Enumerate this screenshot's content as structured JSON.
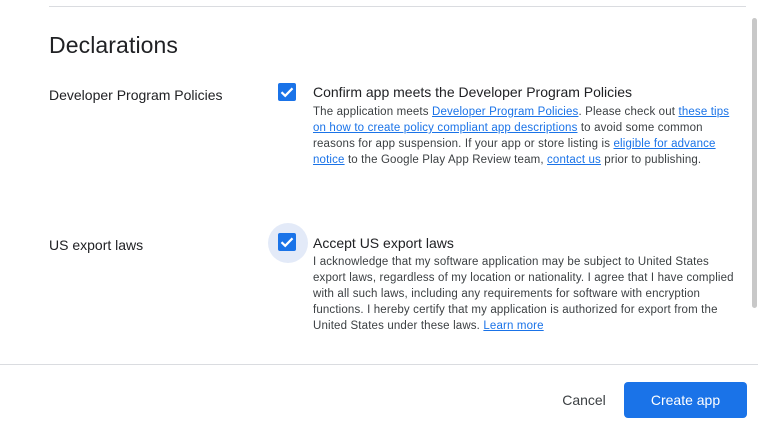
{
  "section": {
    "title": "Declarations"
  },
  "policies": {
    "label": "Developer Program Policies",
    "checked": true,
    "title": "Confirm app meets the Developer Program Policies",
    "desc": {
      "t1": "The application meets ",
      "l1": "Developer Program Policies",
      "t2": ". Please check out ",
      "l2": "these tips on how to create policy compliant app descriptions",
      "t3": " to avoid some common reasons for app suspension. If your app or store listing is ",
      "l3": "eligible for advance notice",
      "t4": " to the Google Play App Review team, ",
      "l4": "contact us",
      "t5": " prior to publishing."
    }
  },
  "export": {
    "label": "US export laws",
    "checked": true,
    "title": "Accept US export laws",
    "desc": {
      "t1": "I acknowledge that my software application may be subject to United States export laws, regardless of my location or nationality. I agree that I have complied with all such laws, including any requirements for software with encryption functions. I hereby certify that my application is authorized for export from the United States under these laws. ",
      "l1": "Learn more"
    }
  },
  "footer": {
    "cancel": "Cancel",
    "create": "Create app"
  },
  "colors": {
    "accent": "#1a73e8",
    "focus_ring": "#e3eaf8"
  },
  "icons": {
    "checkbox": "check-icon"
  }
}
